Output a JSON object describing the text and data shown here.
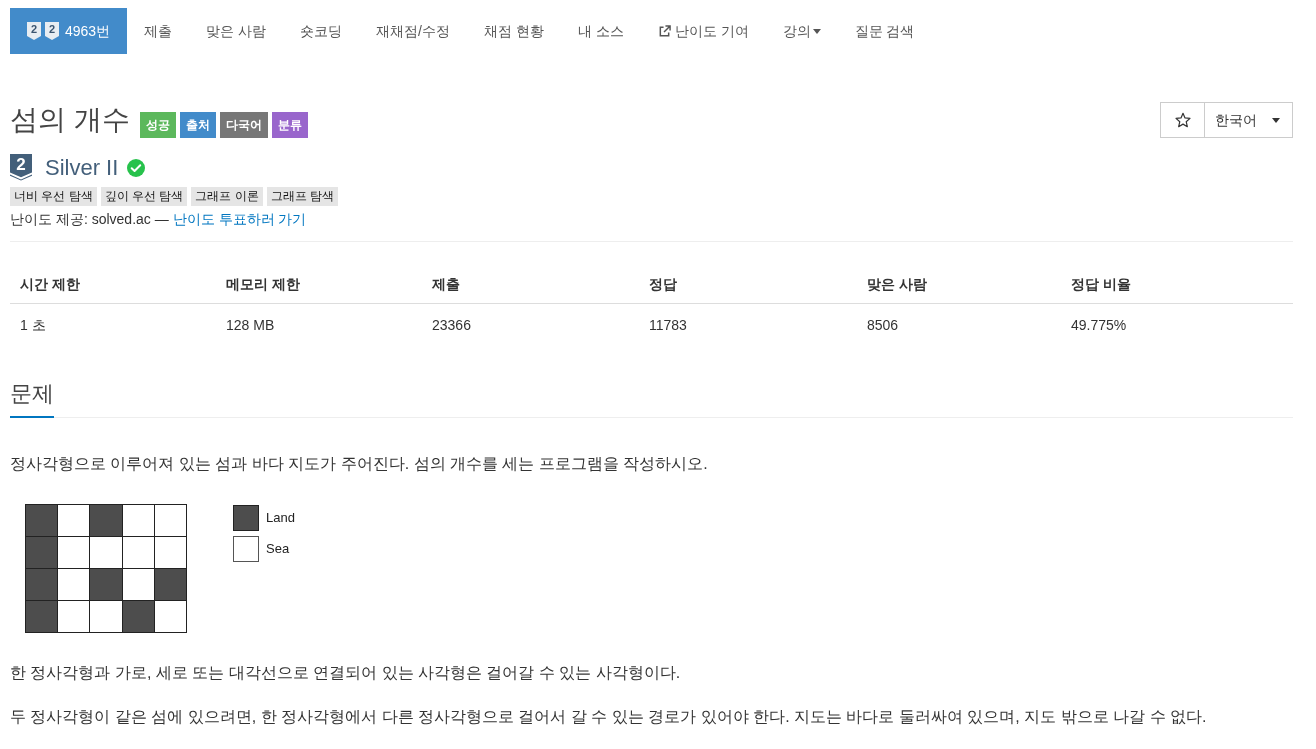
{
  "nav": {
    "items": [
      {
        "kind": "problem",
        "badges": [
          "2",
          "2"
        ],
        "label": "4963번",
        "selected": true
      },
      {
        "kind": "link",
        "label": "제출",
        "selected": false
      },
      {
        "kind": "link",
        "label": "맞은 사람",
        "selected": false
      },
      {
        "kind": "link",
        "label": "숏코딩",
        "selected": false
      },
      {
        "kind": "link",
        "label": "재채점/수정",
        "selected": false
      },
      {
        "kind": "link",
        "label": "채점 현황",
        "selected": false
      },
      {
        "kind": "link",
        "label": "내 소스",
        "selected": false
      },
      {
        "kind": "external",
        "label": "난이도 기여",
        "selected": false
      },
      {
        "kind": "dropdown",
        "label": "강의",
        "selected": false
      },
      {
        "kind": "link",
        "label": "질문 검색",
        "selected": false
      }
    ]
  },
  "header": {
    "title": "섬의 개수",
    "labels": [
      {
        "text": "성공",
        "color": "#5cb85c"
      },
      {
        "text": "출처",
        "color": "#428bca"
      },
      {
        "text": "다국어",
        "color": "#777777"
      },
      {
        "text": "분류",
        "color": "#9966cc"
      }
    ],
    "starred": false,
    "language": "한국어"
  },
  "tier": {
    "badge": "2",
    "name": "Silver II",
    "solved": true
  },
  "tags": [
    "너비 우선 탐색",
    "깊이 우선 탐색",
    "그래프 이론",
    "그래프 탐색"
  ],
  "difficulty_credit": {
    "text": "난이도 제공: solved.ac —",
    "link": "난이도 투표하러 가기"
  },
  "limits_table": {
    "columns": [
      "시간 제한",
      "메모리 제한",
      "제출",
      "정답",
      "맞은 사람",
      "정답 비율"
    ],
    "rows": [
      [
        "1 초",
        "128 MB",
        "23366",
        "11783",
        "8506",
        "49.775%"
      ]
    ]
  },
  "problem": {
    "heading": "문제",
    "body": [
      {
        "kind": "text",
        "text": "정사각형으로 이루어져 있는 섬과 바다 지도가 주어진다. 섬의 개수를 세는 프로그램을 작성하시오."
      },
      {
        "kind": "figure",
        "grid": [
          [
            true,
            false,
            true,
            false,
            false
          ],
          [
            true,
            false,
            false,
            false,
            false
          ],
          [
            true,
            false,
            true,
            false,
            true
          ],
          [
            true,
            false,
            false,
            true,
            false
          ]
        ],
        "legend": [
          {
            "kind": "land",
            "label": "Land"
          },
          {
            "kind": "sea",
            "label": "Sea"
          }
        ]
      },
      {
        "kind": "text",
        "text": "한 정사각형과 가로, 세로 또는 대각선으로 연결되어 있는 사각형은 걸어갈 수 있는 사각형이다."
      },
      {
        "kind": "text",
        "text": "두 정사각형이 같은 섬에 있으려면, 한 정사각형에서 다른 정사각형으로 걸어서 갈 수 있는 경로가 있어야 한다. 지도는 바다로 둘러싸여 있으며, 지도 밖으로 나갈 수 없다."
      }
    ]
  }
}
